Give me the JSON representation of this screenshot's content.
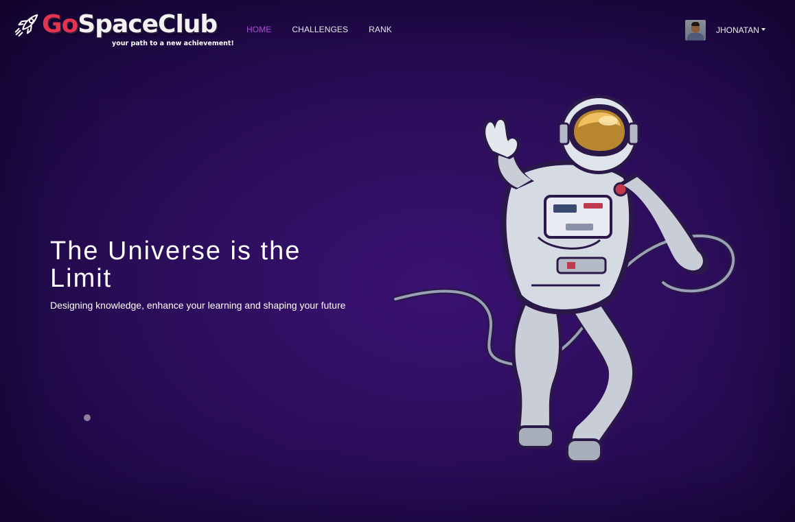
{
  "brand": {
    "name_go": "Go",
    "name_rest": "SpaceClub",
    "tagline": "your path to a new achievement!",
    "icon": "rocket-icon"
  },
  "nav": {
    "items": [
      {
        "label": "HOME",
        "active": true
      },
      {
        "label": "CHALLENGES",
        "active": false
      },
      {
        "label": "RANK",
        "active": false
      }
    ]
  },
  "user": {
    "name": "JHONATAN",
    "icon": "caret-down-icon"
  },
  "hero": {
    "title": "The Universe is the Limit",
    "subtitle": "Designing knowledge, enhance your learning and shaping your future",
    "illustration": "astronaut-illustration"
  },
  "colors": {
    "background": "#2b0d5a",
    "accent_active": "#b04ad8",
    "brand_red": "#e2344f"
  }
}
